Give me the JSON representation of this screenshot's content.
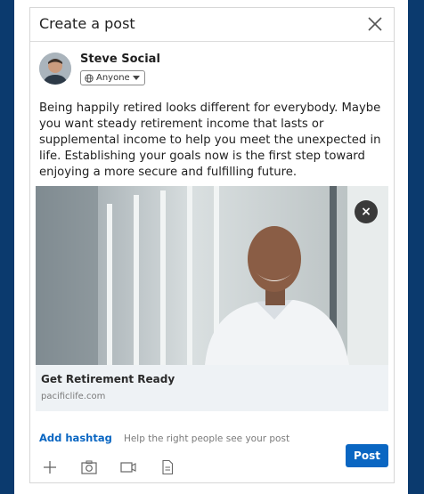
{
  "modal": {
    "title": "Create a post"
  },
  "author": {
    "name": "Steve Social",
    "audience_label": "Anyone"
  },
  "post": {
    "text": "Being happily retired looks different for everybody. Maybe you want steady retirement income that lasts or supplemental income to help you meet the unexpected in life. Establishing your goals now is the first step toward enjoying a more secure and fulfilling future."
  },
  "attachment": {
    "remove_glyph": "×",
    "link_title": "Get Retirement Ready",
    "link_domain": "pacificlife.com"
  },
  "composer": {
    "add_hashtag_label": "Add hashtag",
    "hashtag_hint": "Help the right people see your post",
    "post_label": "Post",
    "tools": [
      "plus-icon",
      "camera-icon",
      "video-icon",
      "document-icon"
    ]
  },
  "colors": {
    "brand_blue": "#0a66c2",
    "page_background": "#0b3a6e",
    "link_preview_bg": "#eef2f5"
  }
}
